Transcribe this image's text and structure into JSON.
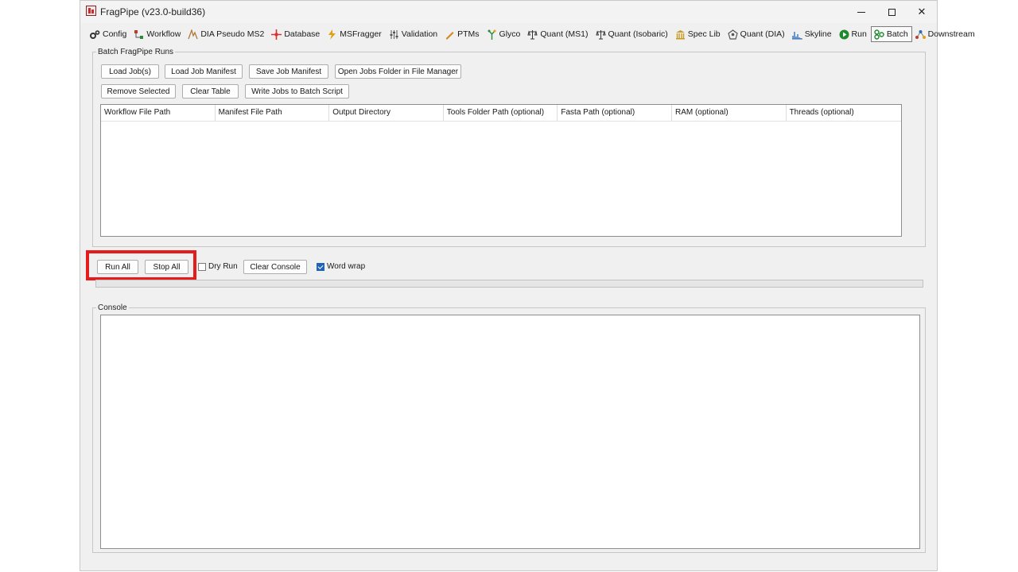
{
  "window": {
    "title": "FragPipe (v23.0-build36)",
    "controls": {
      "minimize": "—",
      "maximize": "☐",
      "close": "✕"
    }
  },
  "tabs": [
    {
      "label": "Config",
      "icon": "gears-icon",
      "color": "#333333"
    },
    {
      "label": "Workflow",
      "icon": "workflow-icon",
      "color": "#c0392b"
    },
    {
      "label": "DIA Pseudo MS2",
      "icon": "peak-icon",
      "color": "#b07a3a"
    },
    {
      "label": "Database",
      "icon": "database-icon",
      "color": "#d93030"
    },
    {
      "label": "MSFragger",
      "icon": "lightning-icon",
      "color": "#e0a010"
    },
    {
      "label": "Validation",
      "icon": "sliders-icon",
      "color": "#555555"
    },
    {
      "label": "PTMs",
      "icon": "pencil-icon",
      "color": "#d08a20"
    },
    {
      "label": "Glyco",
      "icon": "glyco-icon",
      "color": "#2a8a3a"
    },
    {
      "label": "Quant (MS1)",
      "icon": "scale-icon",
      "color": "#333333"
    },
    {
      "label": "Quant (Isobaric)",
      "icon": "scale-icon",
      "color": "#333333"
    },
    {
      "label": "Spec Lib",
      "icon": "library-icon",
      "color": "#c89a20"
    },
    {
      "label": "Quant (DIA)",
      "icon": "network-icon",
      "color": "#555555"
    },
    {
      "label": "Skyline",
      "icon": "spectrum-icon",
      "color": "#2a6ab5"
    },
    {
      "label": "Run",
      "icon": "play-icon",
      "color": "#1e8a2e"
    },
    {
      "label": "Batch",
      "icon": "batch-icon",
      "color": "#1e8a2e",
      "active": true
    },
    {
      "label": "Downstream",
      "icon": "downstream-icon",
      "color": "#c0392b"
    }
  ],
  "batch": {
    "legend": "Batch FragPipe Runs",
    "buttons_row1": [
      "Load Job(s)",
      "Load Job Manifest",
      "Save Job Manifest",
      "Open Jobs Folder in File Manager"
    ],
    "buttons_row2": [
      "Remove Selected",
      "Clear Table",
      "Write Jobs to Batch Script"
    ],
    "table_columns": [
      "Workflow File Path",
      "Manifest File Path",
      "Output Directory",
      "Tools Folder Path (optional)",
      "Fasta Path (optional)",
      "RAM (optional)",
      "Threads (optional)"
    ],
    "rows": []
  },
  "run": {
    "run_all": "Run All",
    "stop_all": "Stop All",
    "dry_run": {
      "label": "Dry Run",
      "checked": false
    },
    "clear_console": "Clear Console",
    "word_wrap": {
      "label": "Word wrap",
      "checked": true
    },
    "progress": 0
  },
  "console": {
    "legend": "Console",
    "content": ""
  },
  "colors": {
    "highlight": "#e51c1c",
    "checkbox_accent": "#1e63b5"
  }
}
